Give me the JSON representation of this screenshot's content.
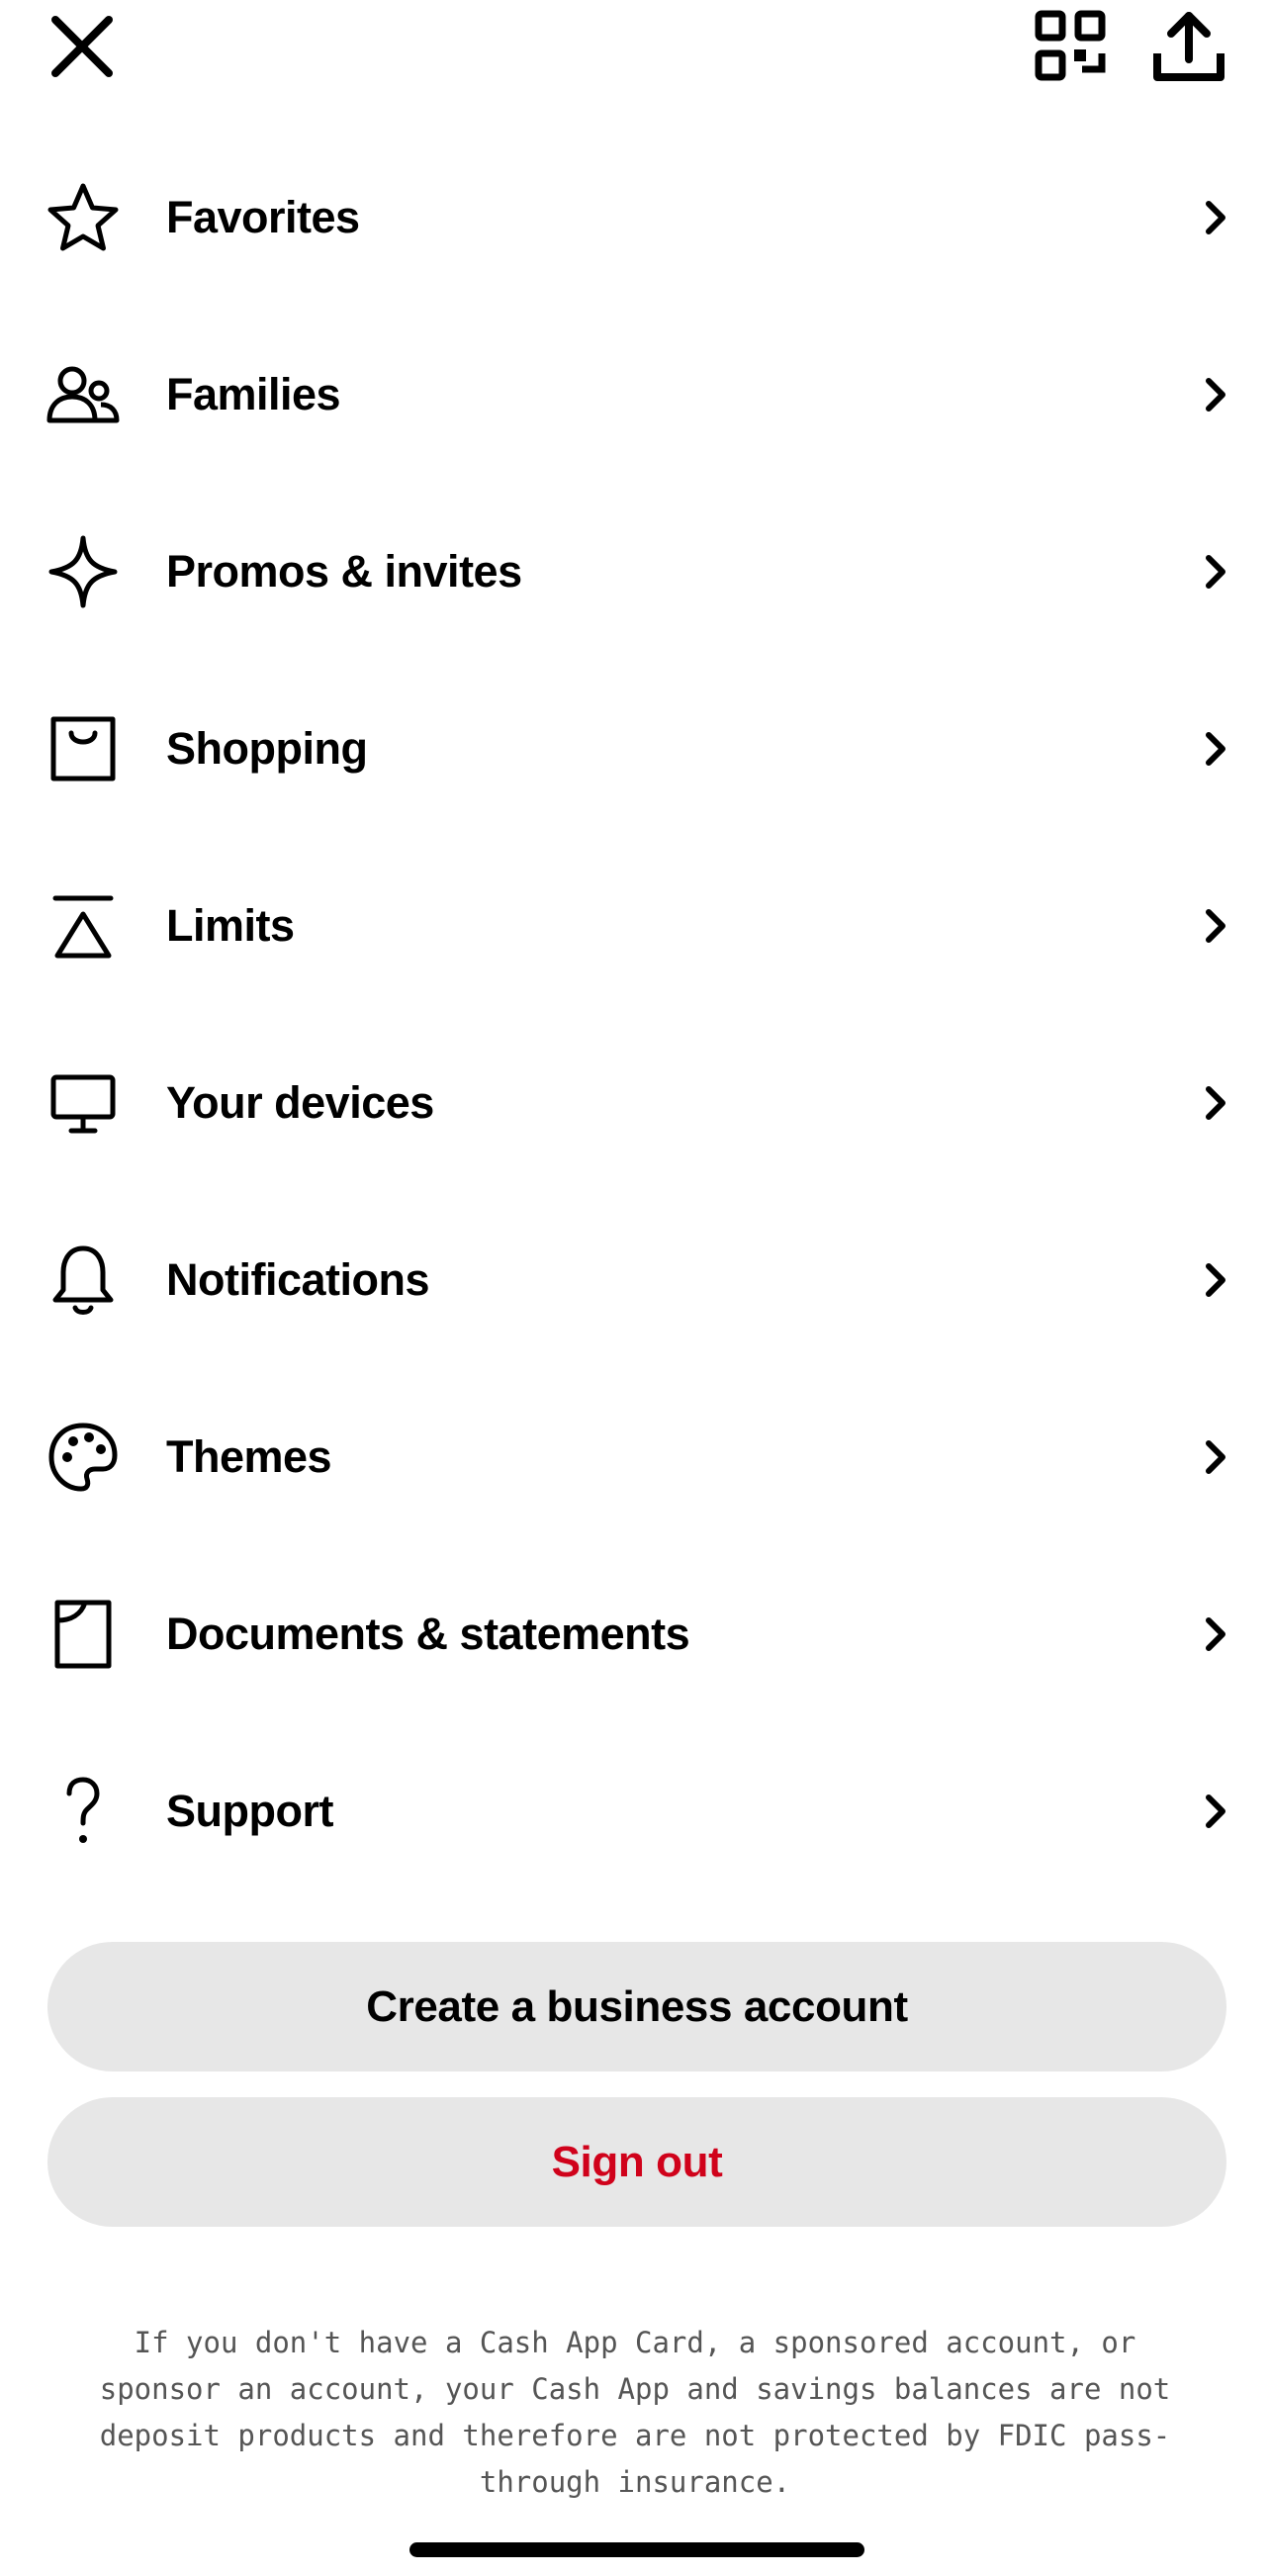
{
  "header": {
    "close_icon": "close-icon",
    "qr_icon": "qr-code-icon",
    "share_icon": "share-icon"
  },
  "menu": {
    "items": [
      {
        "label": "Favorites",
        "icon": "star-icon"
      },
      {
        "label": "Families",
        "icon": "family-icon"
      },
      {
        "label": "Promos & invites",
        "icon": "sparkle-icon"
      },
      {
        "label": "Shopping",
        "icon": "shopping-bag-icon"
      },
      {
        "label": "Limits",
        "icon": "limits-icon"
      },
      {
        "label": "Your devices",
        "icon": "monitor-icon"
      },
      {
        "label": "Notifications",
        "icon": "bell-icon"
      },
      {
        "label": "Themes",
        "icon": "palette-icon"
      },
      {
        "label": "Documents & statements",
        "icon": "document-icon"
      },
      {
        "label": "Support",
        "icon": "question-icon"
      }
    ]
  },
  "actions": {
    "create_business_label": "Create a business account",
    "sign_out_label": "Sign out"
  },
  "disclaimer": "If you don't have a Cash App Card, a sponsored account, or sponsor an account, your Cash App and savings balances are not deposit products and therefore are not protected by FDIC pass-through insurance.",
  "colors": {
    "text": "#000000",
    "sign_out": "#d0021b",
    "button_bg": "#e7e7e7",
    "disclaimer_text": "#555555"
  }
}
